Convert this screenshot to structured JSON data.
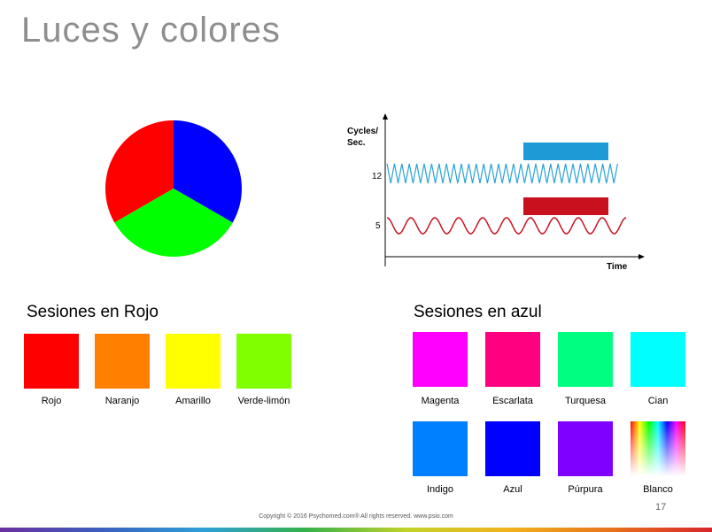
{
  "slide": {
    "title": "Luces y colores",
    "page_number": "17",
    "footer": "Copyright © 2016 Psychomed.com® All rights reserved. www.psio.com"
  },
  "pie": {
    "segments": [
      {
        "name": "red",
        "color": "#ff0000"
      },
      {
        "name": "blue",
        "color": "#0000ff"
      },
      {
        "name": "green",
        "color": "#00ff00"
      }
    ]
  },
  "wave_figure": {
    "y_label_line1": "Cycles/",
    "y_label_line2": "Sec.",
    "x_label": "Time",
    "tick_high": "12",
    "tick_low": "5",
    "high_wave_color": "#2aa3d6",
    "low_wave_color": "#cc1122",
    "blue_bar_color": "#1e9ad6",
    "red_bar_color": "#c8101e"
  },
  "rojo": {
    "title": "Sesiones en Rojo",
    "swatches": [
      {
        "label": "Rojo",
        "color": "#ff0000"
      },
      {
        "label": "Naranjo",
        "color": "#ff7f00"
      },
      {
        "label": "Amarillo",
        "color": "#ffff00"
      },
      {
        "label": "Verde-limón",
        "color": "#7fff00"
      }
    ]
  },
  "azul": {
    "title": "Sesiones en azul",
    "swatches": [
      {
        "label": "Magenta",
        "color": "#ff00ff"
      },
      {
        "label": "Escarlata",
        "color": "#ff0080"
      },
      {
        "label": "Turquesa",
        "color": "#00ff80"
      },
      {
        "label": "Cian",
        "color": "#00ffff"
      },
      {
        "label": "Indigo",
        "color": "#0080ff"
      },
      {
        "label": "Azul",
        "color": "#0000ff"
      },
      {
        "label": "Púrpura",
        "color": "#8000ff"
      },
      {
        "label": "Blanco",
        "color": "spectrum"
      }
    ]
  }
}
